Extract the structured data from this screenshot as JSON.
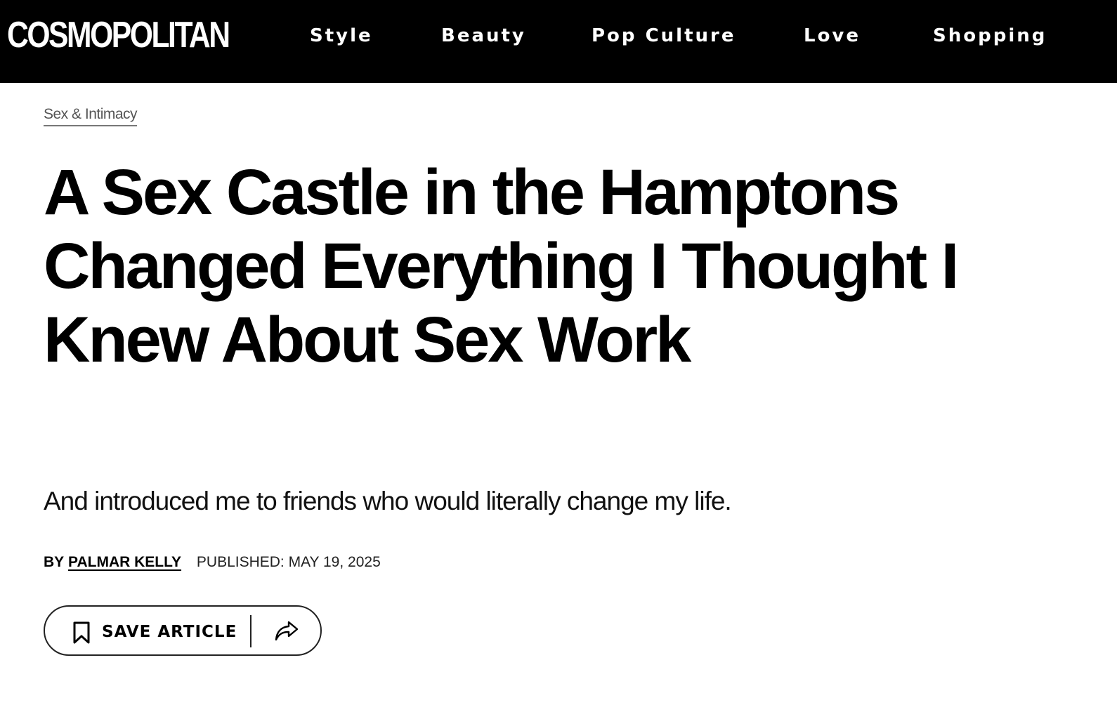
{
  "header": {
    "logo": "COSMOPOLITAN",
    "nav": [
      "Style",
      "Beauty",
      "Pop Culture",
      "Love",
      "Shopping"
    ]
  },
  "article": {
    "category": "Sex & Intimacy",
    "headline": "A Sex Castle in the Hamptons Changed Everything I Thought I Knew About Sex Work",
    "dek": "And introduced me to friends who would literally change my life.",
    "by_prefix": "BY",
    "author": "PALMAR KELLY",
    "published": "PUBLISHED: MAY 19, 2025"
  },
  "actions": {
    "save_label": "SAVE ARTICLE",
    "save_icon": "bookmark-icon",
    "share_icon": "share-arrow-icon"
  },
  "colors": {
    "header_bg": "#000000",
    "text": "#000000",
    "category": "#555555"
  }
}
